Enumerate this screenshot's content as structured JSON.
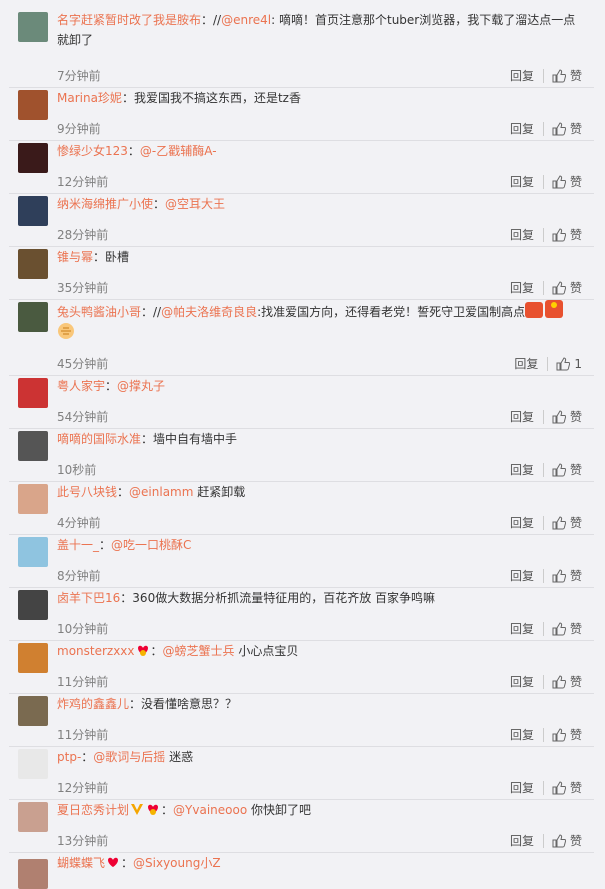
{
  "comments": [
    {
      "user": "名字赶紧暂时改了我是胺布",
      "sep": "：//",
      "mention": "@enre4l",
      "text": ": 嘀嘀！首页注意那个tuber浏览器，我下载了溜达点一点就卸了",
      "time": "7分钟前",
      "reply": "回复",
      "like": "赞",
      "avatar": "#6b8a7a"
    },
    {
      "user": "Marina珍妮",
      "sep": "：",
      "mention": "",
      "text": "我爱国我不搞这东西，还是tz香",
      "time": "9分钟前",
      "reply": "回复",
      "like": "赞",
      "avatar": "#a0522d"
    },
    {
      "user": "惨绿少女123",
      "sep": "：",
      "mention": "@-乙戳辅酶A-",
      "text": "",
      "time": "12分钟前",
      "reply": "回复",
      "like": "赞",
      "avatar": "#3a1a1a"
    },
    {
      "user": "纳米海绵推广小使",
      "sep": "：",
      "mention": "@空耳大王",
      "text": "",
      "time": "28分钟前",
      "reply": "回复",
      "like": "赞",
      "avatar": "#2f3f5a"
    },
    {
      "user": "锥与幂",
      "sep": "：",
      "mention": "",
      "text": "卧槽",
      "time": "35分钟前",
      "reply": "回复",
      "like": "赞",
      "avatar": "#6a5030"
    },
    {
      "user": "兔头鸭酱油小哥",
      "sep": "：//",
      "mention": "@帕夫洛维奇良良",
      "text": ":找准爱国方向，还得看老党！誓死守卫爱国制高点",
      "time": "45分钟前",
      "reply": "回复",
      "like": "1",
      "avatar": "#4a5a40"
    },
    {
      "user": "粤人家宇",
      "sep": "：",
      "mention": "@撑丸子",
      "text": "",
      "time": "54分钟前",
      "reply": "回复",
      "like": "赞",
      "avatar": "#c33"
    },
    {
      "user": "嘀嘀的国际水准",
      "sep": "：",
      "mention": "",
      "text": "墙中自有墙中手",
      "time": "10秒前",
      "reply": "回复",
      "like": "赞",
      "avatar": "#555"
    },
    {
      "user": "此号八块钱",
      "sep": "：",
      "mention": "@einlamm",
      "text": " 赶紧卸载",
      "time": "4分钟前",
      "reply": "回复",
      "like": "赞",
      "avatar": "#d9a58a"
    },
    {
      "user": "盖十一_",
      "sep": "：",
      "mention": "@吃一口桃酥C",
      "text": "",
      "time": "8分钟前",
      "reply": "回复",
      "like": "赞",
      "avatar": "#8fc4e0"
    },
    {
      "user": "卤羊下巴16",
      "sep": "：",
      "mention": "",
      "text": "360做大数据分析抓流量特征用的，百花齐放 百家争鸣嘛",
      "time": "10分钟前",
      "reply": "回复",
      "like": "赞",
      "avatar": "#444"
    },
    {
      "user": "monsterzxxx",
      "sep": "：",
      "mention": "@螃芝蟹士兵",
      "text": " 小心点宝贝",
      "time": "11分钟前",
      "reply": "回复",
      "like": "赞",
      "avatar": "#d08030"
    },
    {
      "user": "炸鸡的鑫鑫儿",
      "sep": "：",
      "mention": "",
      "text": "没看懂啥意思？？",
      "time": "11分钟前",
      "reply": "回复",
      "like": "赞",
      "avatar": "#7a6a50"
    },
    {
      "user": "ptp-",
      "sep": "：",
      "mention": "@歌词与后摇",
      "text": " 迷惑",
      "time": "12分钟前",
      "reply": "回复",
      "like": "赞",
      "avatar": "#e8e8e8"
    },
    {
      "user": "夏日恋秀计划",
      "sep": "：",
      "mention": "@Yvaineooo",
      "text": " 你快卸了吧",
      "time": "13分钟前",
      "reply": "回复",
      "like": "赞",
      "avatar": "#c9a090"
    }
  ],
  "partial": {
    "user": "蝴蝶蝶飞",
    "mention": "@Sixyoung小Z"
  }
}
